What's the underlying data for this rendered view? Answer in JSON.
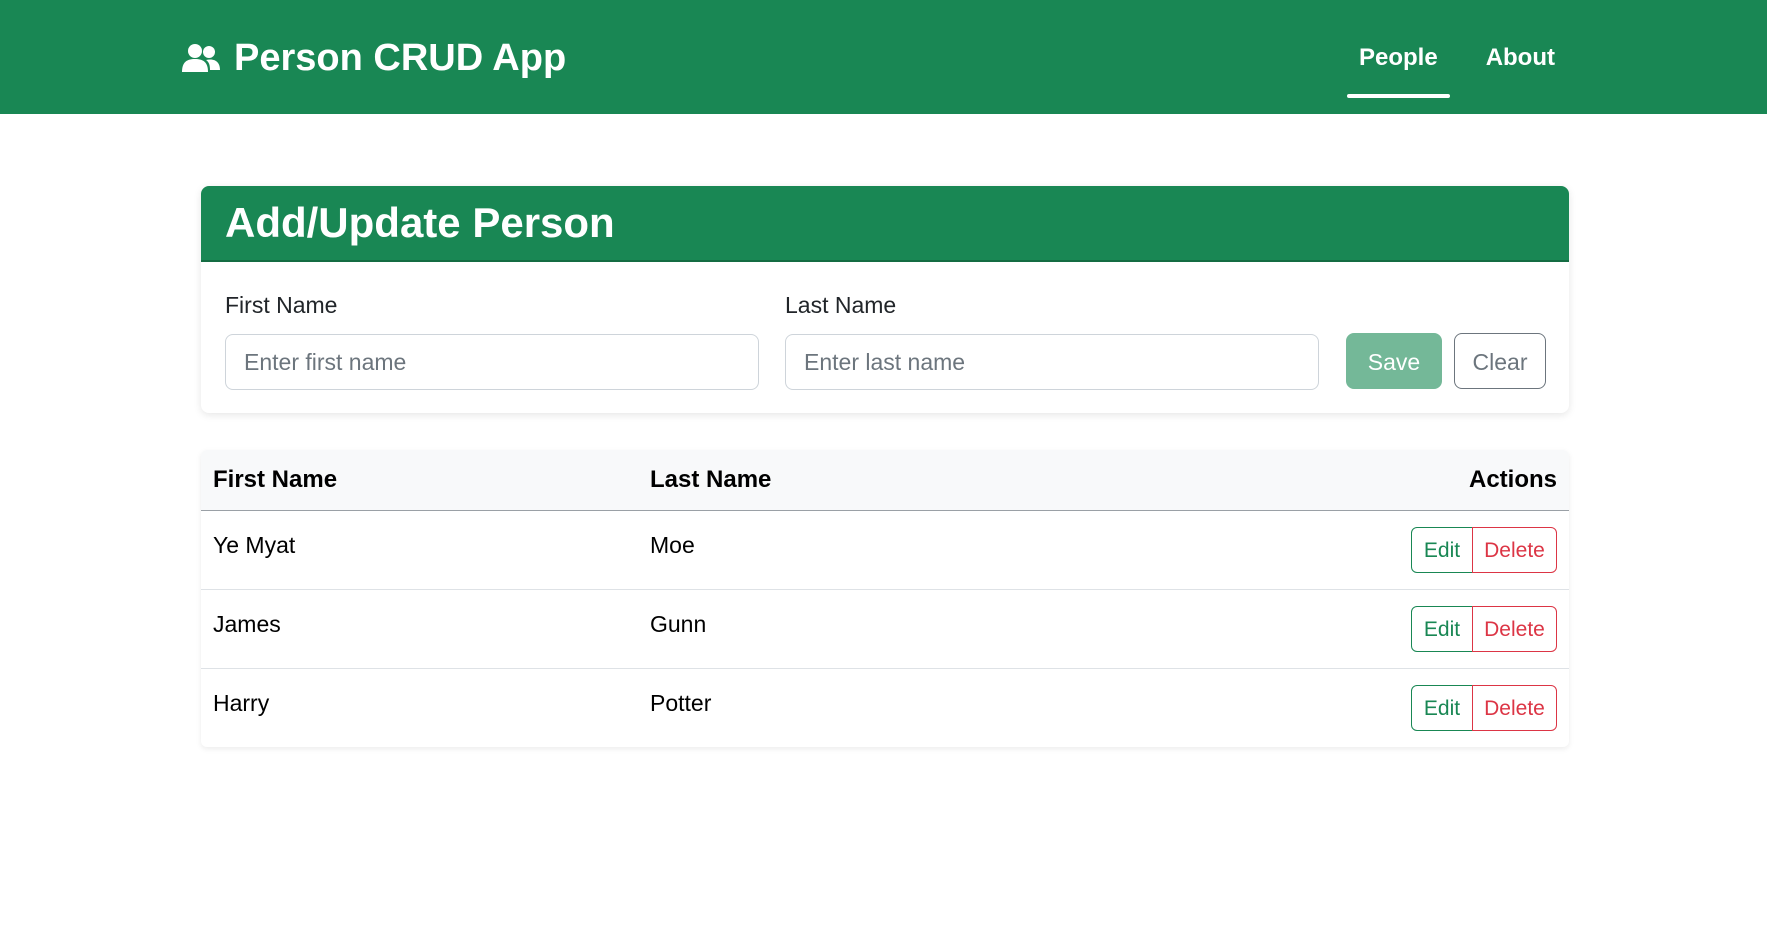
{
  "app": {
    "title": "Person CRUD App",
    "brand_icon": "users-icon",
    "colors": {
      "primary": "#198754",
      "danger": "#dc3545",
      "secondary": "#6c757d"
    }
  },
  "nav": {
    "items": [
      {
        "label": "People",
        "active": true
      },
      {
        "label": "About",
        "active": false
      }
    ]
  },
  "form": {
    "title": "Add/Update Person",
    "first_name": {
      "label": "First Name",
      "placeholder": "Enter first name",
      "value": ""
    },
    "last_name": {
      "label": "Last Name",
      "placeholder": "Enter last name",
      "value": ""
    },
    "save_label": "Save",
    "clear_label": "Clear"
  },
  "table": {
    "headers": {
      "first": "First Name",
      "last": "Last Name",
      "actions": "Actions"
    },
    "rows": [
      {
        "first": "Ye Myat",
        "last": "Moe",
        "edit": "Edit",
        "delete": "Delete"
      },
      {
        "first": "James",
        "last": "Gunn",
        "edit": "Edit",
        "delete": "Delete"
      },
      {
        "first": "Harry",
        "last": "Potter",
        "edit": "Edit",
        "delete": "Delete"
      }
    ]
  }
}
